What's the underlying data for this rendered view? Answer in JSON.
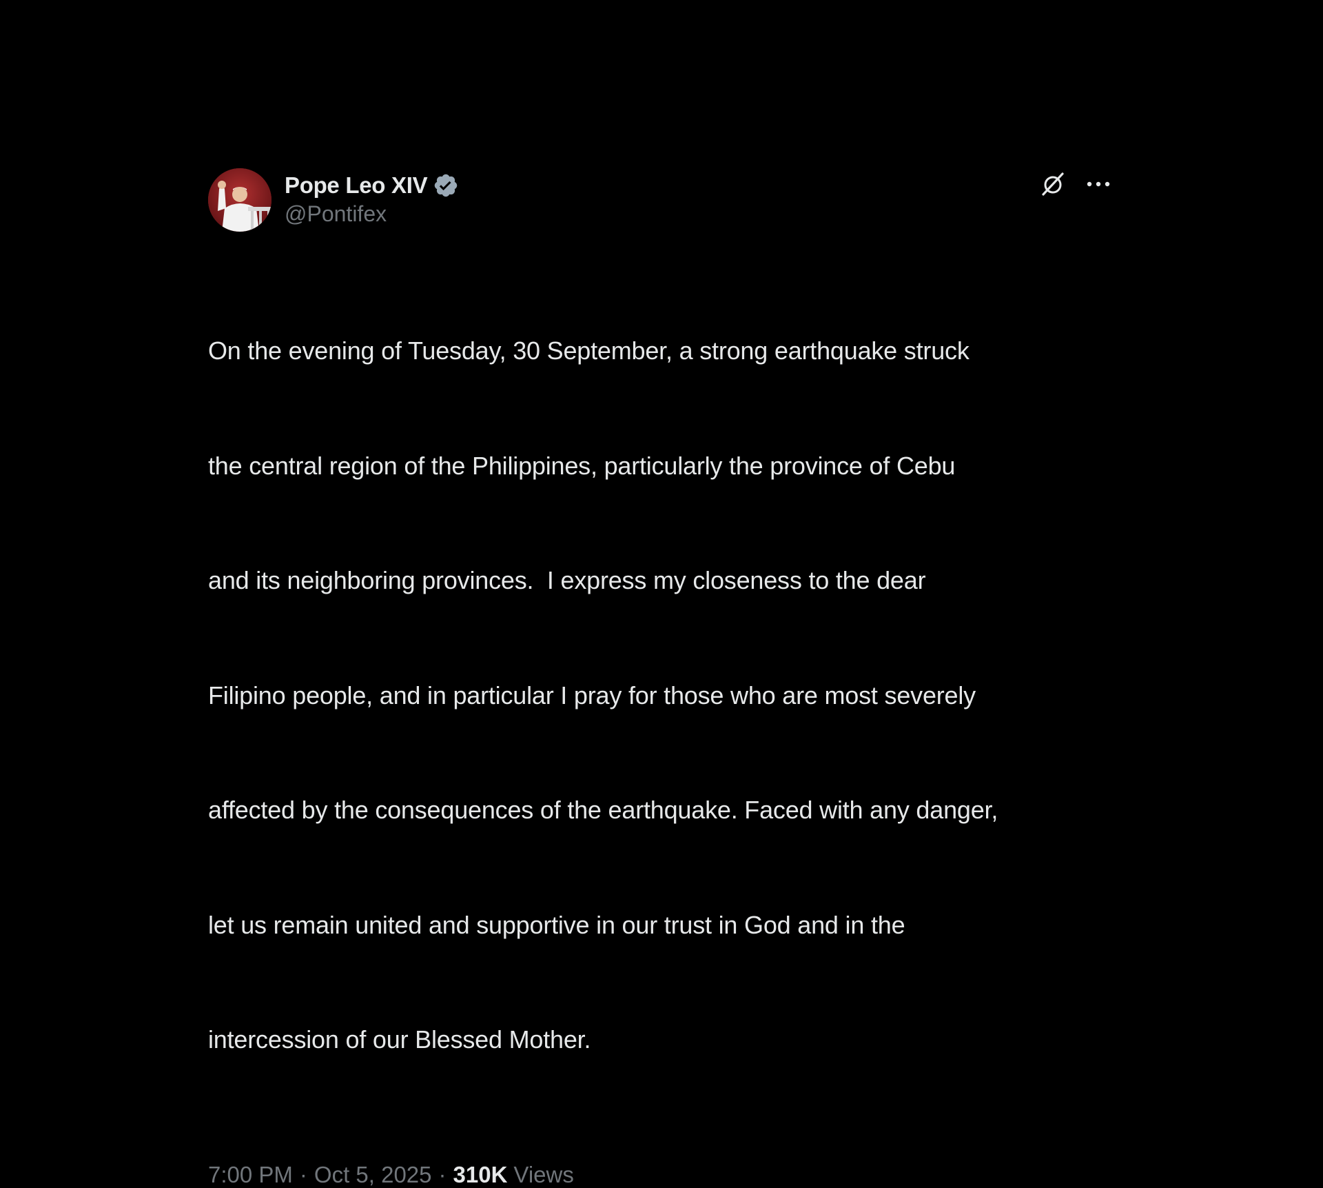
{
  "author": {
    "display_name": "Pope Leo XIV",
    "handle": "@Pontifex",
    "verified": true,
    "verified_color": "#9aa9b6"
  },
  "icons": {
    "grok": "grok-icon",
    "more": "more-icon",
    "verified": "verified-badge-icon"
  },
  "post": {
    "lines": [
      "On the evening of Tuesday, 30 September, a strong earthquake struck",
      "the central region of the Philippines, particularly the province of Cebu",
      "and its neighboring provinces.  I express my closeness to the dear",
      "Filipino people, and in particular I pray for those who are most severely",
      "affected by the consequences of the earthquake. Faced with any danger,",
      "let us remain united and supportive in our trust in God and in the",
      "intercession of our Blessed Mother."
    ]
  },
  "meta": {
    "time": "7:00 PM",
    "separator": "·",
    "date": "Oct 5, 2025",
    "views_count": "310K",
    "views_label": "Views"
  },
  "colors": {
    "background": "#000000",
    "primary_text": "#e7e9ea",
    "secondary_text": "#71767b"
  }
}
